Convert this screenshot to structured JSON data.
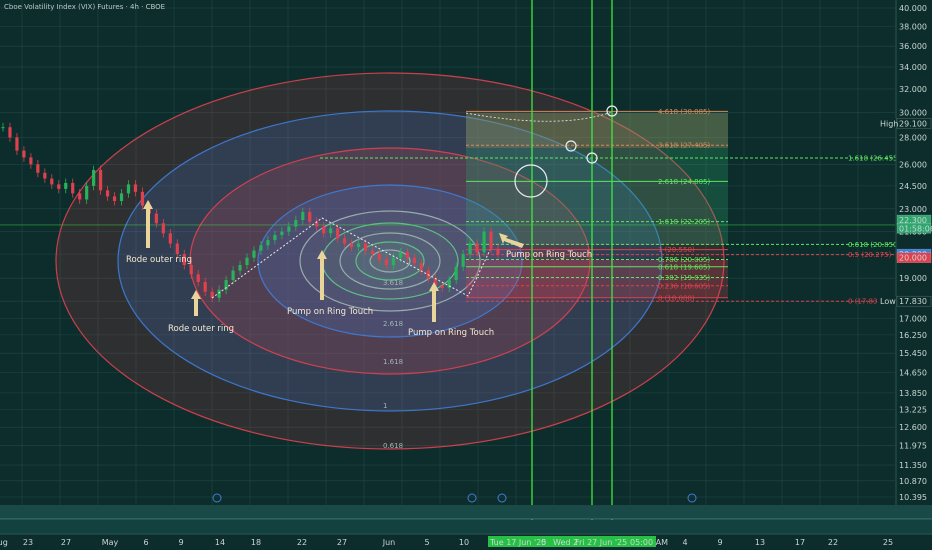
{
  "header": {
    "title": "Cboe Volatility Index (VIX) Futures · 4h · CBOE"
  },
  "colors": {
    "background": "#0d2d2c",
    "grid": "#1e4745",
    "ring_red": "#e0414f",
    "ring_blue": "#3f7ed8",
    "green_line": "#3ee83e",
    "candle_up": "#27b35a",
    "candle_down": "#e0414f",
    "annotation_arrow": "#e9d59a",
    "zone_green": "#2fa66e",
    "zone_peach": "#d48a5c"
  },
  "chart_data": {
    "type": "candlestick",
    "y_axis": {
      "min": 10.0,
      "max": 40.0,
      "scale": "log",
      "position": "right",
      "ticks": [
        "40.000",
        "38.000",
        "36.000",
        "34.000",
        "32.000",
        "30.000",
        "28.000",
        "26.000",
        "24.500",
        "23.000",
        "21.600",
        "20.300",
        "19.000",
        "17.830",
        "17.000",
        "16.250",
        "15.450",
        "14.650",
        "13.850",
        "13.225",
        "12.600",
        "11.975",
        "11.350",
        "10.870",
        "10.395"
      ]
    },
    "x_axis": {
      "ticks": [
        "23",
        "27",
        "May",
        "6",
        "9",
        "14",
        "18",
        "22",
        "27",
        "Jun",
        "5",
        "10",
        "",
        "4",
        "9",
        "13",
        "17",
        "22",
        "25",
        "Aug"
      ]
    },
    "crosshair_labels": [
      "Tue 17 Jun '25",
      "0",
      "Wed 2",
      "Fri 27 Jun '25",
      "05:00 AM"
    ],
    "price_labels": [
      {
        "text": "High",
        "value": 29.1,
        "tag": "29.100"
      },
      {
        "text": "",
        "value": 22.3,
        "tag": "22.300"
      },
      {
        "text": "",
        "value": 21.8,
        "tag": "01:58:06"
      },
      {
        "text": "",
        "value": 20.3,
        "tag": "20.300"
      },
      {
        "text": "",
        "value": 20.1,
        "tag": "20.000"
      },
      {
        "text": "Low",
        "value": 17.83,
        "tag": "17.830"
      }
    ],
    "fib_levels": [
      {
        "label": "4.618 (30.085)",
        "value": 30.085
      },
      {
        "label": "3.618 (27.405)",
        "value": 27.405
      },
      {
        "label": "1.618 (26.455)",
        "value": 26.455
      },
      {
        "label": "2.618 (24.805)",
        "value": 24.805
      },
      {
        "label": "1.618 (22.205)",
        "value": 22.205
      },
      {
        "label": "0.618 (20.850)",
        "value": 20.85
      },
      {
        "label": "1 (20.550)",
        "value": 20.55
      },
      {
        "label": "0.5 (20.275)",
        "value": 20.275
      },
      {
        "label": "0.786 (20.005)",
        "value": 20.005
      },
      {
        "label": "0.618 (19.605)",
        "value": 19.605
      },
      {
        "label": "0.382 (19.035)",
        "value": 19.035
      },
      {
        "label": "0.236 (18.605)",
        "value": 18.605
      },
      {
        "label": "0 (18.000)",
        "value": 18.0
      },
      {
        "label": "0 (17.830)",
        "value": 17.83
      }
    ],
    "series": [
      {
        "values": [
          28.8,
          28.0,
          27.0,
          26.5,
          26.0,
          25.4,
          25.0,
          24.6,
          24.3,
          24.7,
          24.0,
          23.6,
          24.5,
          25.6,
          24.2,
          23.8,
          23.5,
          24.0,
          24.6,
          24.1,
          23.2,
          22.7,
          22.1,
          21.5,
          20.9,
          20.3,
          19.7,
          19.2,
          18.8,
          18.3,
          18.0,
          18.4,
          18.9,
          19.4,
          19.7,
          20.1,
          20.5,
          20.8,
          21.1,
          21.4,
          21.6,
          21.9,
          22.3,
          22.8,
          22.2,
          21.9,
          21.5,
          21.8,
          21.2,
          20.9,
          20.7,
          20.9,
          20.5,
          20.3,
          20.0,
          19.7,
          20.1,
          20.4,
          20.1,
          19.8,
          19.4,
          19.0,
          18.6,
          18.5,
          18.9,
          19.6,
          20.3,
          20.9,
          20.4,
          21.6,
          20.6,
          20.3
        ]
      }
    ],
    "ring_labels": [
      "0.618",
      "1",
      "1.618",
      "2.618",
      "3.618"
    ],
    "annotations": [
      {
        "text": "Rode outer ring"
      },
      {
        "text": "Rode outer ring"
      },
      {
        "text": "Pump on Ring Touch"
      },
      {
        "text": "Pump on Ring Touch"
      },
      {
        "text": "Pump on Ring Touch"
      }
    ]
  }
}
